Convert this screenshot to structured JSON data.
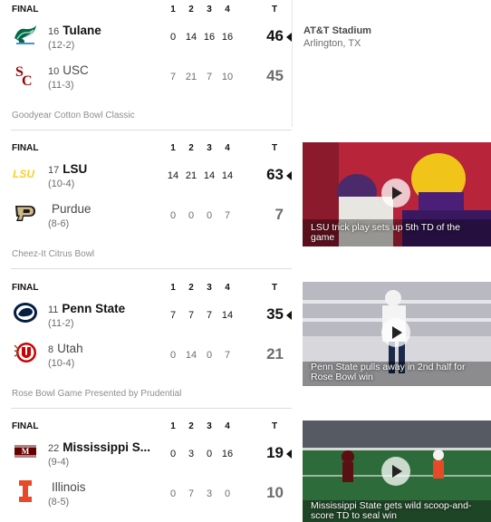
{
  "quarter_headers": [
    "1",
    "2",
    "3",
    "4"
  ],
  "total_header": "T",
  "games": [
    {
      "status": "FINAL",
      "bowl": "Goodyear Cotton Bowl Classic",
      "venue": {
        "name": "AT&T Stadium",
        "location": "Arlington, TX"
      },
      "teams": [
        {
          "rank": "16",
          "name": "Tulane",
          "record": "(12-2)",
          "scores": [
            "0",
            "14",
            "16",
            "16"
          ],
          "total": "46",
          "winner": true,
          "logo_icon": "tulane-wave-logo",
          "color": "#006747"
        },
        {
          "rank": "10",
          "name": "USC",
          "record": "(11-3)",
          "scores": [
            "7",
            "21",
            "7",
            "10"
          ],
          "total": "45",
          "winner": false,
          "logo_icon": "usc-sc-logo",
          "color": "#990000"
        }
      ]
    },
    {
      "status": "FINAL",
      "bowl": "Cheez-It Citrus Bowl",
      "video_caption": "LSU trick play sets up 5th TD of the game",
      "teams": [
        {
          "rank": "17",
          "name": "LSU",
          "record": "(10-4)",
          "scores": [
            "14",
            "21",
            "14",
            "14"
          ],
          "total": "63",
          "winner": true,
          "logo_icon": "lsu-logo",
          "color": "#FDD023"
        },
        {
          "rank": "",
          "name": "Purdue",
          "record": "(8-6)",
          "scores": [
            "0",
            "0",
            "0",
            "7"
          ],
          "total": "7",
          "winner": false,
          "logo_icon": "purdue-p-logo",
          "color": "#CEB888"
        }
      ]
    },
    {
      "status": "FINAL",
      "bowl": "Rose Bowl Game Presented by Prudential",
      "video_caption": "Penn State pulls away in 2nd half for Rose Bowl win",
      "teams": [
        {
          "rank": "11",
          "name": "Penn State",
          "record": "(11-2)",
          "scores": [
            "7",
            "7",
            "7",
            "14"
          ],
          "total": "35",
          "winner": true,
          "logo_icon": "penn-state-lion-logo",
          "color": "#041E42"
        },
        {
          "rank": "8",
          "name": "Utah",
          "record": "(10-4)",
          "scores": [
            "0",
            "14",
            "0",
            "7"
          ],
          "total": "21",
          "winner": false,
          "logo_icon": "utah-u-logo",
          "color": "#CC0000"
        }
      ]
    },
    {
      "status": "FINAL",
      "bowl": "",
      "video_caption": "Mississippi State gets wild scoop-and-score TD to seal win",
      "teams": [
        {
          "rank": "22",
          "name": "Mississippi S...",
          "record": "(9-4)",
          "scores": [
            "0",
            "3",
            "0",
            "16"
          ],
          "total": "19",
          "winner": true,
          "logo_icon": "mississippi-state-logo",
          "color": "#660000"
        },
        {
          "rank": "",
          "name": "Illinois",
          "record": "(8-5)",
          "scores": [
            "0",
            "7",
            "3",
            "0"
          ],
          "total": "10",
          "winner": false,
          "logo_icon": "illinois-i-logo",
          "color": "#E84A27"
        }
      ]
    }
  ]
}
